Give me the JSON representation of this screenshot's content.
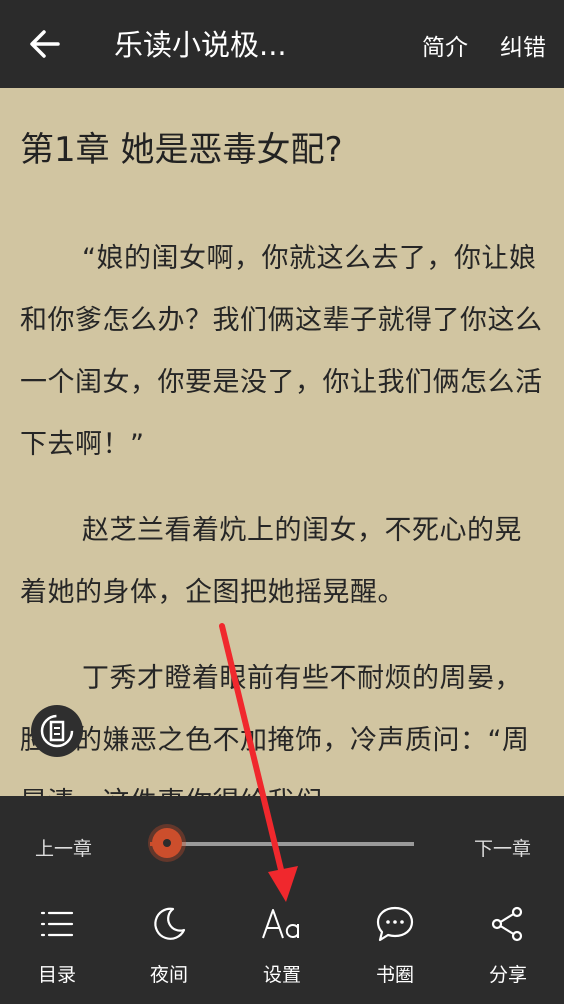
{
  "header": {
    "title": "乐读小说极...",
    "intro_label": "简介",
    "correct_label": "纠错"
  },
  "chapter": {
    "title": "第1章   她是恶毒女配?",
    "paragraphs": [
      "“娘的闺女啊，你就这么去了，你让娘和你爹怎么办？我们俩这辈子就得了你这么一个闺女，你要是没了，你让我们俩怎么活下去啊！”",
      "赵芝兰看着炕上的闺女，不死心的晃着她的身体，企图把她摇晃醒。",
      "丁秀才瞪着眼前有些不耐烦的周晏，脸上的嫌恶之色不加掩饰，冷声质问：“周晏清，这件事你得给我们"
    ]
  },
  "reader_nav": {
    "prev_label": "上一章",
    "next_label": "下一章",
    "progress": 0.03
  },
  "toolbar": {
    "items": [
      {
        "label": "目录",
        "icon": "list-icon"
      },
      {
        "label": "夜间",
        "icon": "moon-icon"
      },
      {
        "label": "设置",
        "icon": "font-icon"
      },
      {
        "label": "书圈",
        "icon": "chat-icon"
      },
      {
        "label": "分享",
        "icon": "share-icon"
      }
    ]
  },
  "colors": {
    "page_bg": "#d1c5a1",
    "bar_bg": "#2b2b2b",
    "accent": "#cc4e2c",
    "annotation_arrow": "#f0282d"
  }
}
